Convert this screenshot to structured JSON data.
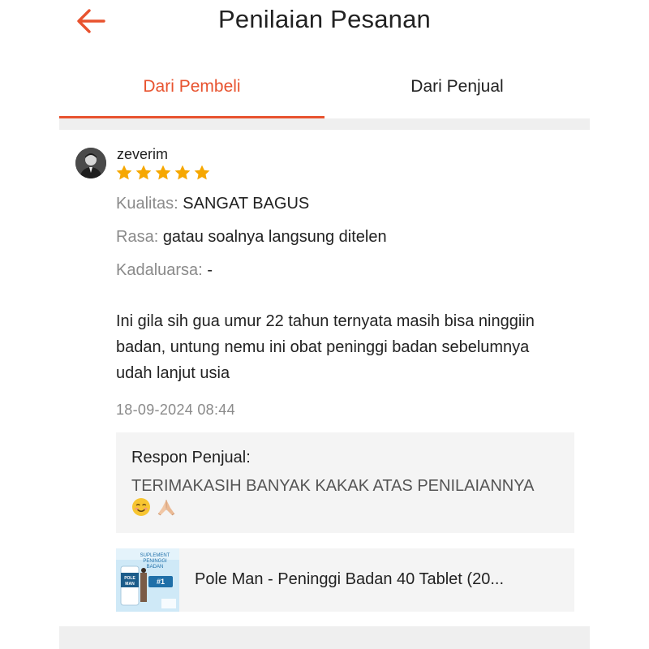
{
  "header": {
    "title": "Penilaian Pesanan",
    "back_icon": "arrow-left-icon",
    "accent_color": "#e8532f"
  },
  "tabs": [
    {
      "label": "Dari Pembeli",
      "active": true
    },
    {
      "label": "Dari Penjual",
      "active": false
    }
  ],
  "review": {
    "username": "zeverim",
    "rating": 5,
    "rating_max": 5,
    "star_color": "#f6a700",
    "attributes": [
      {
        "key": "Kualitas:",
        "value": "SANGAT BAGUS"
      },
      {
        "key": "Rasa:",
        "value": "gatau soalnya langsung ditelen"
      },
      {
        "key": "Kadaluarsa:",
        "value": "-"
      }
    ],
    "comment": "Ini gila sih gua umur 22 tahun ternyata masih bisa ninggiin badan, untung nemu ini obat peninggi badan sebelumnya udah lanjut usia",
    "date": "18-09-2024 08:44",
    "seller_response": {
      "label": "Respon Penjual:",
      "text": "TERIMAKASIH BANYAK KAKAK  ATAS PENILAIANNYA"
    },
    "product": {
      "name": "Pole Man - Peninggi Badan 40 Tablet (20...",
      "image_text": {
        "line1": "SUPLEMENT",
        "line2": "PENINGGI",
        "line3": "BADAN",
        "brand": "POLE MAN",
        "rank": "#1"
      }
    }
  }
}
